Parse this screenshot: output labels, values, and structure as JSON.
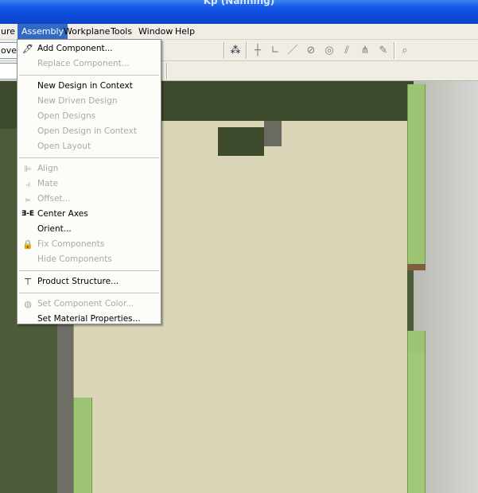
{
  "titlebar": {
    "title": "Kp (Nanning)"
  },
  "menubar": {
    "items": [
      {
        "label": "ure"
      },
      {
        "label": "Assembly"
      },
      {
        "label": "Workplane"
      },
      {
        "label": "Tools"
      },
      {
        "label": "Window"
      },
      {
        "label": "Help"
      }
    ]
  },
  "toolbar": {
    "left_field": "ove C",
    "icons": [
      "point-icon",
      "constraint-plus-icon",
      "constraint-angle-icon",
      "line-icon",
      "tangent-icon",
      "concentric-icon",
      "parallel-icon",
      "symmetric-icon",
      "fix-icon",
      "zoom-icon"
    ]
  },
  "assembly_menu": {
    "items": [
      {
        "label": "Add Component...",
        "enabled": true,
        "icon": "add-component-icon"
      },
      {
        "label": "Replace Component...",
        "enabled": false,
        "icon": ""
      },
      {
        "separator": true
      },
      {
        "label": "New Design in Context",
        "enabled": true,
        "icon": ""
      },
      {
        "label": "New Driven Design",
        "enabled": false,
        "icon": ""
      },
      {
        "label": "Open Designs",
        "enabled": false,
        "icon": ""
      },
      {
        "label": "Open Design in Context",
        "enabled": false,
        "icon": ""
      },
      {
        "label": "Open Layout",
        "enabled": false,
        "icon": ""
      },
      {
        "separator": true
      },
      {
        "label": "Align",
        "enabled": false,
        "icon": "align-icon"
      },
      {
        "label": "Mate",
        "enabled": false,
        "icon": "mate-icon"
      },
      {
        "label": "Offset...",
        "enabled": false,
        "icon": "offset-icon"
      },
      {
        "label": "Center Axes",
        "enabled": true,
        "icon": "center-axes-icon"
      },
      {
        "label": "Orient...",
        "enabled": true,
        "icon": ""
      },
      {
        "label": "Fix Components",
        "enabled": false,
        "icon": "fix-components-icon"
      },
      {
        "label": "Hide Components",
        "enabled": false,
        "icon": ""
      },
      {
        "separator": true
      },
      {
        "label": "Product Structure...",
        "enabled": true,
        "icon": "product-structure-icon"
      },
      {
        "separator": true
      },
      {
        "label": "Set Component Color...",
        "enabled": false,
        "icon": "color-icon"
      },
      {
        "label": "Set Material Properties...",
        "enabled": true,
        "icon": ""
      }
    ]
  }
}
